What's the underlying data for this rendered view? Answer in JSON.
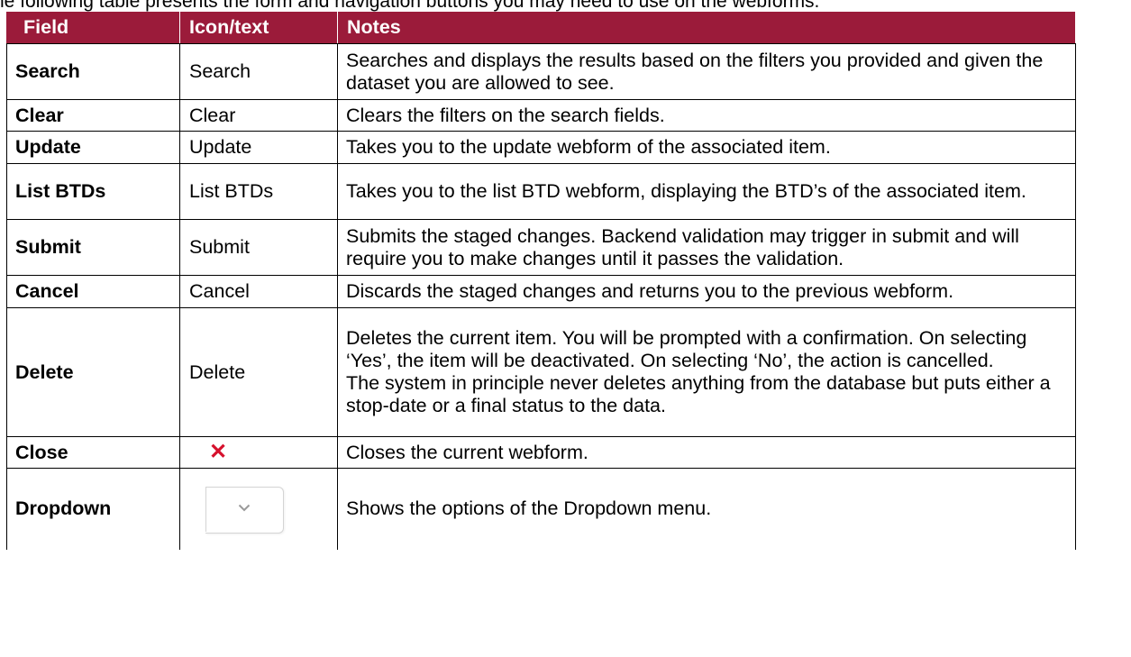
{
  "intro": "he following table presents the form and navigation buttons you may need to use on the webforms.",
  "headers": {
    "field": "Field",
    "icon": "Icon/text",
    "notes": "Notes"
  },
  "header_color": "#9b1b3a",
  "rows": [
    {
      "field": "Search",
      "icon": "Search",
      "notes": "Searches and displays the results based on the filters you provided and given the dataset you are allowed to see."
    },
    {
      "field": "Clear",
      "icon": "Clear",
      "notes": "Clears the filters on the search fields."
    },
    {
      "field": "Update",
      "icon": "Update",
      "notes": "Takes you to the update webform of the associated item."
    },
    {
      "field": "List BTDs",
      "icon": "List BTDs",
      "notes": "Takes you to the list BTD webform, displaying the BTD’s of the associated item."
    },
    {
      "field": "Submit",
      "icon": "Submit",
      "notes": "Submits the staged changes. Backend validation may trigger in submit and will require you to make changes until it passes the validation."
    },
    {
      "field": "Cancel",
      "icon": "Cancel",
      "notes": "Discards the staged changes and returns you to the previous webform."
    },
    {
      "field": "Delete",
      "icon": "Delete",
      "notes": "Deletes the current item. You will be prompted with a confirmation. On selecting ‘Yes’, the item will be deactivated. On selecting ‘No’, the action is cancelled.",
      "notes2": "The system in principle never deletes anything from the database but puts either a stop-date or a final status to the data."
    },
    {
      "field": "Close",
      "icon_name": "close-x-icon",
      "icon_color": "#d6112d",
      "notes": "Closes the current webform."
    },
    {
      "field": "Dropdown",
      "icon_name": "dropdown-chevron-icon",
      "notes": "Shows the options of the Dropdown menu."
    }
  ]
}
